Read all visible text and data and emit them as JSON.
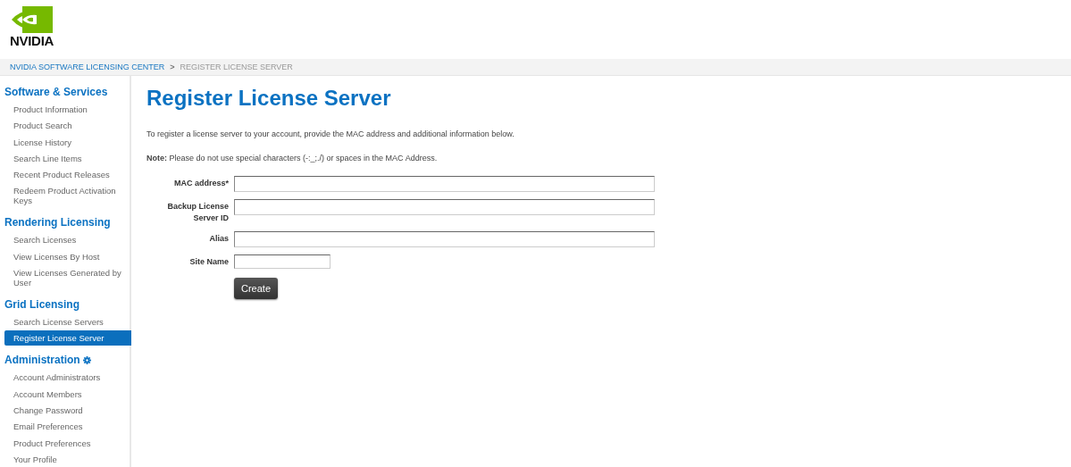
{
  "logo": {
    "wordmark": "NVIDIA"
  },
  "breadcrumb": [
    {
      "label": "NVIDIA SOFTWARE LICENSING CENTER",
      "kind": "link"
    },
    {
      "label": ">",
      "kind": "separator"
    },
    {
      "label": "REGISTER LICENSE SERVER",
      "kind": "current"
    }
  ],
  "sidebar": {
    "sections": [
      {
        "title": "Software & Services",
        "gear": false,
        "items": [
          {
            "label": "Product Information",
            "selected": false
          },
          {
            "label": "Product Search",
            "selected": false
          },
          {
            "label": "License History",
            "selected": false
          },
          {
            "label": "Search Line Items",
            "selected": false
          },
          {
            "label": "Recent Product Releases",
            "selected": false
          },
          {
            "label": "Redeem Product Activation Keys",
            "selected": false
          }
        ]
      },
      {
        "title": "Rendering Licensing",
        "gear": false,
        "items": [
          {
            "label": "Search Licenses",
            "selected": false
          },
          {
            "label": "View Licenses By Host",
            "selected": false
          },
          {
            "label": "View Licenses Generated by User",
            "selected": false
          }
        ]
      },
      {
        "title": "Grid Licensing",
        "gear": false,
        "items": [
          {
            "label": "Search License Servers",
            "selected": false
          },
          {
            "label": "Register License Server",
            "selected": true
          }
        ]
      },
      {
        "title": "Administration",
        "gear": true,
        "items": [
          {
            "label": "Account Administrators",
            "selected": false
          },
          {
            "label": "Account Members",
            "selected": false
          },
          {
            "label": "Change Password",
            "selected": false
          },
          {
            "label": "Email Preferences",
            "selected": false
          },
          {
            "label": "Product Preferences",
            "selected": false
          },
          {
            "label": "Your Profile",
            "selected": false
          }
        ]
      }
    ]
  },
  "main": {
    "title": "Register License Server",
    "intro": "To register a license server to your account, provide the MAC address and additional information below.",
    "note": "**Note:** Please do not use special characters (-:_;./) or spaces in the MAC Address.",
    "fields": [
      {
        "label": "MAC address*",
        "kind": "wide"
      },
      {
        "label": "Backup License Server ID",
        "kind": "wide"
      },
      {
        "label": "Alias",
        "kind": "wide"
      },
      {
        "label": "Site Name",
        "kind": "short"
      }
    ],
    "button": "Create"
  }
}
